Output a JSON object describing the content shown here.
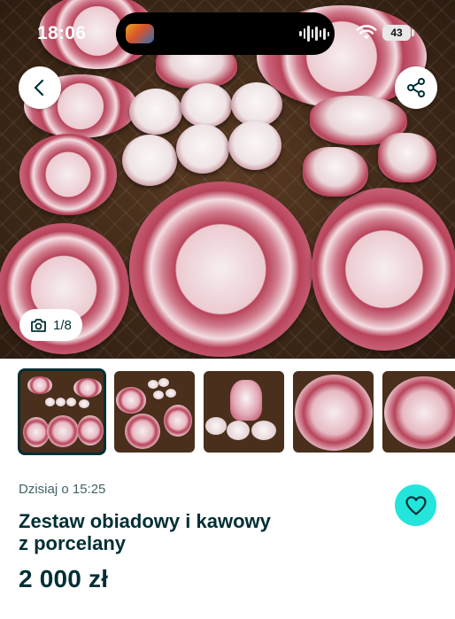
{
  "status_bar": {
    "time": "18:06",
    "battery": "43"
  },
  "gallery": {
    "counter": "1/8",
    "icons": {
      "back": "chevron-left-icon",
      "share": "share-icon",
      "camera": "camera-icon"
    }
  },
  "listing": {
    "date": "Dzisiaj o 15:25",
    "title_line1": "Zestaw obiadowy i kawowy",
    "title_line2": "z porcelany",
    "price": "2 000 zł",
    "favorite_icon": "heart-icon"
  },
  "colors": {
    "accent": "#23e5db",
    "text_primary": "#002f34",
    "text_secondary": "#406367",
    "porcelain_red": "#b8435a"
  }
}
